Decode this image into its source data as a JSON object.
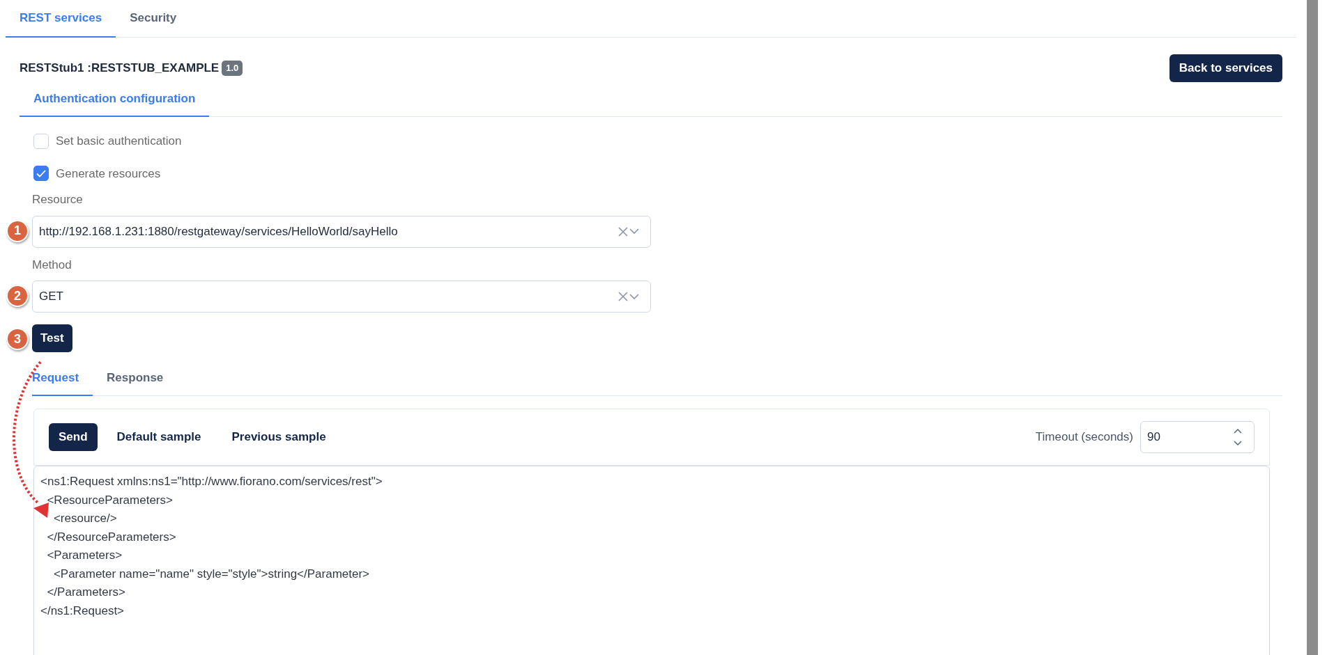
{
  "tabs": [
    {
      "label": "REST services",
      "selected": true
    },
    {
      "label": "Security",
      "selected": false
    }
  ],
  "service": {
    "name": "RESTStub1 :RESTSTUB_EXAMPLE",
    "version": "1.0"
  },
  "back_button": "Back to services",
  "config_tabs": [
    {
      "label": "Authentication configuration",
      "selected": true
    }
  ],
  "options": [
    {
      "label": "Set basic authentication",
      "checked": false
    },
    {
      "label": "Generate resources",
      "checked": true
    }
  ],
  "fields": [
    {
      "label": "Resource",
      "value": "http://192.168.1.231:1880/restgateway/services/HelloWorld/sayHello",
      "marker": "1"
    },
    {
      "label": "Method",
      "value": "GET",
      "marker": "2"
    }
  ],
  "test_button": {
    "label": "Test",
    "marker": "3"
  },
  "request_tabs": [
    {
      "label": "Request",
      "selected": true
    },
    {
      "label": "Response",
      "selected": false
    }
  ],
  "toolbar": {
    "buttons": [
      {
        "label": "Send",
        "kind": "primary"
      },
      {
        "label": "Default sample",
        "kind": "plain"
      },
      {
        "label": "Previous sample",
        "kind": "plain"
      }
    ],
    "timeout": {
      "label": "Timeout (seconds)",
      "value": "90"
    }
  },
  "code": "<ns1:Request xmlns:ns1=\"http://www.fiorano.com/services/rest\">\n  <ResourceParameters>\n    <resource/>\n  </ResourceParameters>\n  <Parameters>\n    <Parameter name=\"name\" style=\"style\">string</Parameter>\n  </Parameters>\n</ns1:Request>"
}
